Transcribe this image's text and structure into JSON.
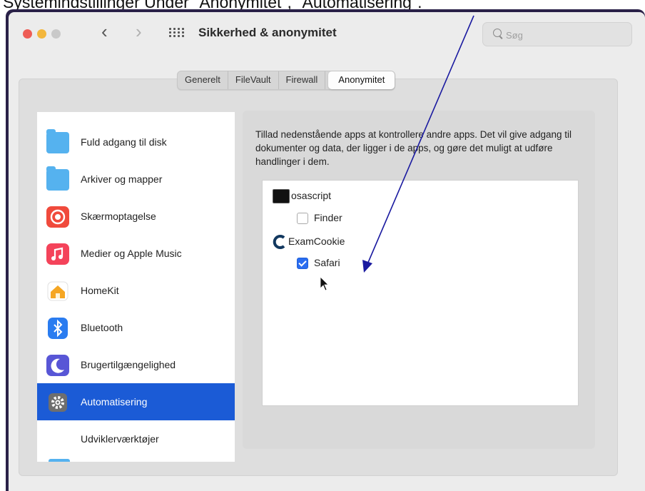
{
  "caption": "Systemindstillinger Under \"Anonymitet\", \"Automatisering\".",
  "window": {
    "title": "Sikkerhed & anonymitet",
    "back_glyph": "‹",
    "forward_glyph": "›"
  },
  "search": {
    "placeholder": "Søg"
  },
  "tabs": [
    {
      "label": "Generelt",
      "selected": false
    },
    {
      "label": "FileVault",
      "selected": false
    },
    {
      "label": "Firewall",
      "selected": false
    },
    {
      "label": "Anonymitet",
      "selected": true
    }
  ],
  "sidebar": {
    "items": [
      {
        "label": "Fuld adgang til disk",
        "icon": "folder-icon",
        "color": "#55b2ef"
      },
      {
        "label": "Arkiver og mapper",
        "icon": "folder-icon",
        "color": "#55b2ef"
      },
      {
        "label": "Skærmoptagelse",
        "icon": "screen-recording-icon",
        "color": "#f04a3c"
      },
      {
        "label": "Medier og Apple Music",
        "icon": "music-icon",
        "color": "#f4435a"
      },
      {
        "label": "HomeKit",
        "icon": "home-icon",
        "color": "#f5a623"
      },
      {
        "label": "Bluetooth",
        "icon": "bluetooth-icon",
        "color": "#2a7cf0"
      },
      {
        "label": "Brugertilgængelighed",
        "icon": "accessibility-moon-icon",
        "color": "#5856d6"
      },
      {
        "label": "Automatisering",
        "icon": "gear-icon",
        "color": "#6e6e6e",
        "selected": true
      },
      {
        "label": "Udviklerværktøjer",
        "icon": "",
        "color": ""
      }
    ]
  },
  "right_pane": {
    "description": "Tillad nedenstående apps at kontrollere andre apps. Det vil give adgang til dokumenter og data, der ligger i de apps, og gøre det muligt at udføre handlinger i dem.",
    "apps": [
      {
        "name": "osascript",
        "icon": "terminal-icon",
        "children": [
          {
            "name": "Finder",
            "checked": false
          }
        ]
      },
      {
        "name": "ExamCookie",
        "icon": "examcookie-icon",
        "children": [
          {
            "name": "Safari",
            "checked": true
          }
        ]
      }
    ]
  },
  "colors": {
    "selection": "#1b5bd6",
    "annotation_arrow": "#1a1aa0",
    "checkbox_checked": "#2a6df0"
  }
}
